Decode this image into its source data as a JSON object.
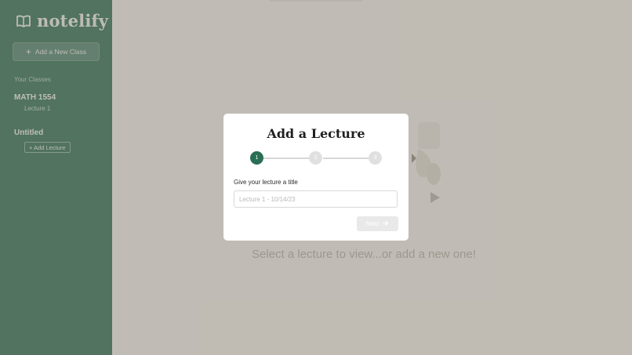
{
  "app": {
    "brand": "notelify"
  },
  "sidebar": {
    "add_class_label": "Add a New Class",
    "section_label": "Your Classes",
    "classes": [
      {
        "name": "MATH 1554",
        "lectures": [
          "Lecture 1"
        ]
      },
      {
        "name": "Untitled",
        "add_lecture_label": "+ Add Lecture"
      }
    ]
  },
  "main": {
    "empty_state": "Select a lecture to view...or add a new one!"
  },
  "modal": {
    "title": "Add a Lecture",
    "steps": [
      "1",
      "2",
      "3"
    ],
    "active_step": 1,
    "field_label": "Give your lecture a title",
    "input_placeholder": "Lecture 1 - 10/14/23",
    "input_value": "",
    "next_label": "Next"
  },
  "colors": {
    "sidebar": "#2a6e55",
    "accent": "#2a6e55",
    "overlay": "rgba(128,122,110,0.45)"
  },
  "icons": {
    "logo": "open-book-icon",
    "add": "plus-icon",
    "next": "arrow-right-icon"
  }
}
